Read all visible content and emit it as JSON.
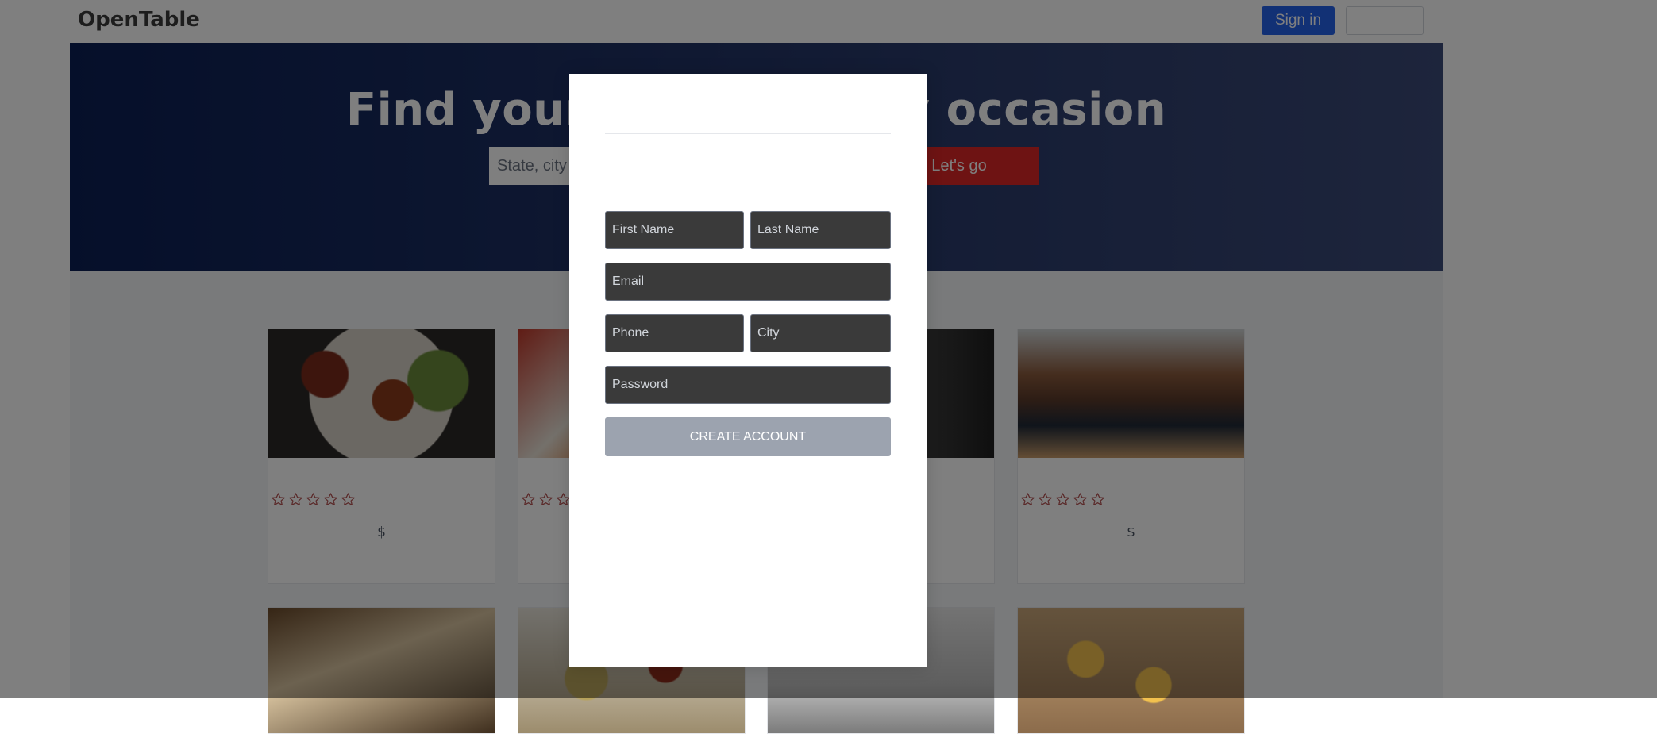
{
  "header": {
    "logo": "OpenTable",
    "signin_label": "Sign in",
    "signup_label": ""
  },
  "hero": {
    "title": "Find your table for any occasion",
    "search_placeholder": "State, city or town",
    "go_label": "Let's go"
  },
  "cards": [
    {
      "price": "$"
    },
    {
      "price": "$"
    },
    {
      "price": "$"
    },
    {
      "price": "$"
    }
  ],
  "modal": {
    "title": "",
    "first_name_placeholder": "First Name",
    "last_name_placeholder": "Last Name",
    "email_placeholder": "Email",
    "phone_placeholder": "Phone",
    "city_placeholder": "City",
    "password_placeholder": "Password",
    "create_label": "CREATE ACCOUNT"
  },
  "colors": {
    "primary_blue": "#2563eb",
    "accent_red": "#dc2626",
    "field_bg": "#3a3a3a",
    "button_disabled": "#9ca3af"
  }
}
